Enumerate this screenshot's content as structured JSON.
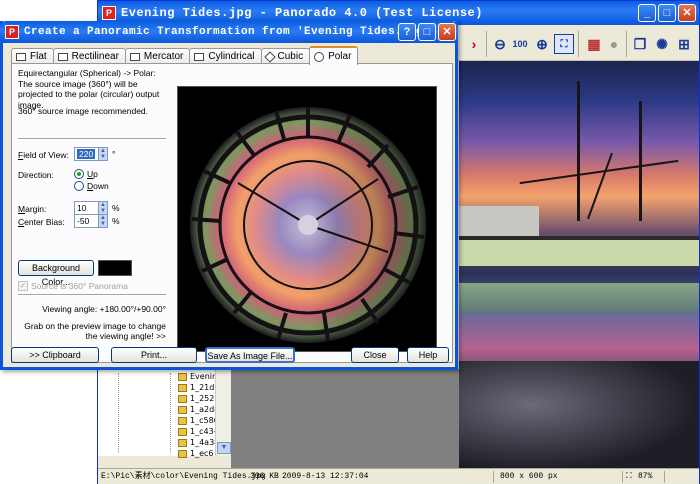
{
  "main_window": {
    "title": "Evening Tides.jpg  -  Panorado 4.0 (Test License)",
    "app_icon": "P",
    "toolbar": {
      "zoom_100_label": "100"
    },
    "file_tree": {
      "items": [
        "Evenin",
        "1_21d8",
        "1_252c",
        "1_a2d8",
        "1_c586",
        "1_c43-",
        "1_4a38",
        "1_ec6"
      ]
    },
    "status": {
      "path": "E:\\Pic\\素材\\color\\Evening Tides.jpg",
      "size": "306 KB",
      "date": "2009-8-13 12:37:04",
      "dimensions": "800 x 600 px",
      "zoom": "87%"
    }
  },
  "dialog": {
    "title": "Create a Panoramic Transformation from 'Evening Tides.jpg'",
    "app_icon": "P",
    "tabs": [
      {
        "label": "Flat",
        "icon": "flat-icon"
      },
      {
        "label": "Rectilinear",
        "icon": "rectilinear-icon"
      },
      {
        "label": "Mercator",
        "icon": "mercator-icon"
      },
      {
        "label": "Cylindrical",
        "icon": "cylindrical-icon"
      },
      {
        "label": "Cubic",
        "icon": "cubic-icon"
      },
      {
        "label": "Polar",
        "icon": "polar-icon",
        "active": true
      }
    ],
    "description": "Equirectangular (Spherical) -> Polar:\nThe source image (360°) will be projected to the polar (circular) output image.",
    "recommendation": "360° source image recommended.",
    "field_of_view": {
      "label_u": "F",
      "label_rest": "ield of View:",
      "value": "220",
      "unit": "°"
    },
    "direction": {
      "label": "Direction:",
      "options": [
        {
          "label": "Up",
          "u": "U",
          "rest": "p",
          "selected": true
        },
        {
          "label": "Down",
          "u": "D",
          "rest": "own",
          "selected": false
        }
      ]
    },
    "margin": {
      "label_u": "M",
      "label_rest": "argin:",
      "value": "10",
      "unit": "%"
    },
    "center_bias": {
      "label_u": "C",
      "label_rest": "enter Bias:",
      "value": "-50",
      "unit": "%"
    },
    "background_color_button": "Background Color...",
    "background_color": "#000000",
    "source_is_360": "Source is 360° Panorama",
    "viewing_angle": "Viewing angle: +180.00°/+90.00°",
    "hint": "Grab on the preview image to change the viewing angle!  >>",
    "buttons": {
      "clipboard": ">> Clipboard",
      "print": "Print...",
      "save_as": "Save As Image File...",
      "close": "Close",
      "help": "Help"
    }
  },
  "colors": {
    "title_bar": "#0a55d8",
    "dialog_bg": "#ece9d8",
    "tab_highlight": "#e68b2c",
    "preview_bg": "#000000"
  }
}
